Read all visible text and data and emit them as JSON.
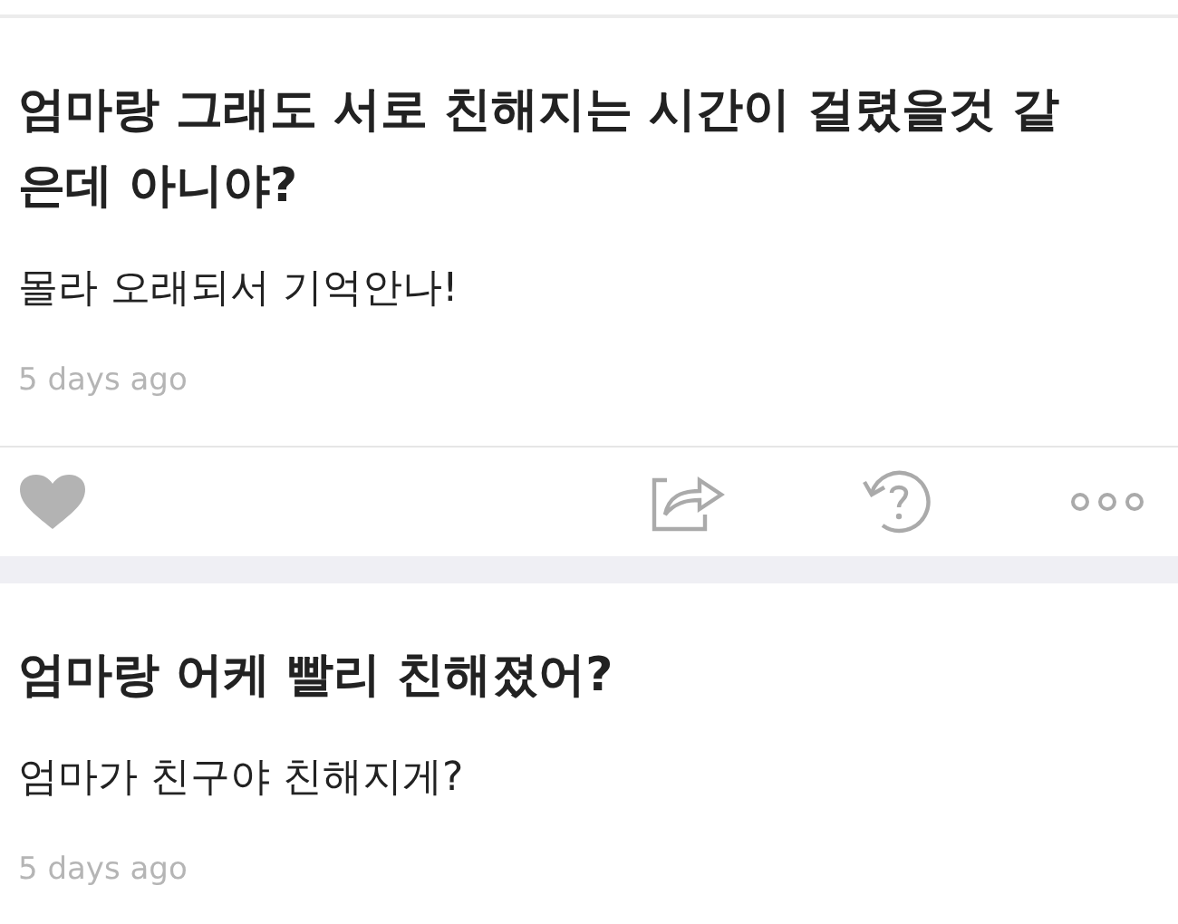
{
  "feed": [
    {
      "kind": "post",
      "question": "엄마랑 그래도 서로 친해지는 시간이 걸렸을것 같은데 아니야?",
      "answer": "몰라 오래되서 기억안나!",
      "time": "5 days ago"
    },
    {
      "kind": "actions"
    },
    {
      "kind": "post",
      "question": "엄마랑 어케 빨리 친해졌어?",
      "answer": "엄마가 친구야 친해지게?",
      "time": "5 days ago"
    }
  ]
}
